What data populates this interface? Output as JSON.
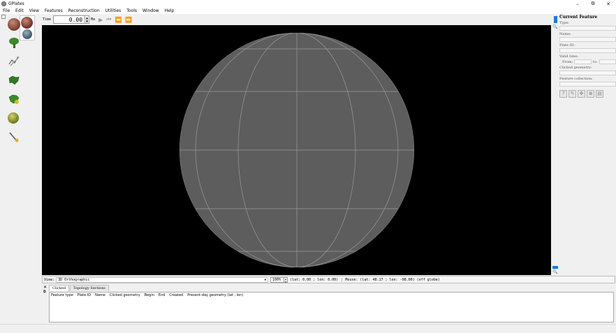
{
  "window": {
    "title": "GPlates",
    "controls": {
      "minimize": "–",
      "maximize": "⧉",
      "close": "✕"
    }
  },
  "menu": [
    "File",
    "Edit",
    "View",
    "Features",
    "Reconstruction",
    "Utilities",
    "Tools",
    "Window",
    "Help"
  ],
  "left_toolbar": {
    "tools": [
      {
        "name": "drag-globe-tool",
        "icon": "red-globe-icon"
      },
      {
        "name": "zoom-globe-tool",
        "icon": "red-globe-zoom-icon"
      },
      {
        "name": "measure-distance-tool",
        "icon": "globe-lens-icon"
      },
      {
        "name": "choose-feature-tool",
        "icon": "green-tree-icon"
      },
      {
        "name": "digitise-tool",
        "icon": "pencil-line-icon"
      },
      {
        "name": "topology-tool",
        "icon": "green-continent-icon"
      },
      {
        "name": "edit-topology-tool",
        "icon": "green-continent-arrow-icon"
      },
      {
        "name": "small-circle-tool",
        "icon": "yellow-globe-icon"
      },
      {
        "name": "pole-manipulation-tool",
        "icon": "pen-nib-icon"
      }
    ]
  },
  "time_toolbar": {
    "label": "Time",
    "value": "0.00",
    "unit": "Ma",
    "buttons": [
      "▶",
      "⏮",
      "⏪",
      "⏩"
    ]
  },
  "current_feature": {
    "title": "Current Feature",
    "type_label": "Type:",
    "name_label": "Name:",
    "plate_id_label": "Plate ID:",
    "valid_time_label": "Valid time:",
    "from_label": "From:",
    "to_label": "to:",
    "clicked_geometry_label": "Clicked geometry:",
    "feature_collection_label": "Feature collection:",
    "buttons": [
      "query-feature-icon",
      "edit-feature-icon",
      "move-vertex-icon",
      "delete-vertex-icon",
      "delete-feature-icon"
    ]
  },
  "statusbar": {
    "view_label": "View:",
    "view_value": "3D Orthographic",
    "zoom_value": "100%",
    "camera": "(lat: 0.00 ; lon: 0.00)",
    "mouse": "Mouse: (lat: 48.17 ; lon: -98.00) (off globe)"
  },
  "bottom_dock": {
    "tabs": [
      "Clicked",
      "Topology Sections"
    ],
    "columns": [
      "Feature type",
      "Plate ID",
      "Name",
      "Clicked geometry",
      "Begin",
      "End",
      "Created",
      "Present-day geometry (lat ; lon)"
    ]
  },
  "colors": {
    "globe_fill": "#5d5d5d",
    "graticule": "#9a9a9a",
    "viewport_bg": "#000000",
    "accent": "#1e78d7"
  }
}
